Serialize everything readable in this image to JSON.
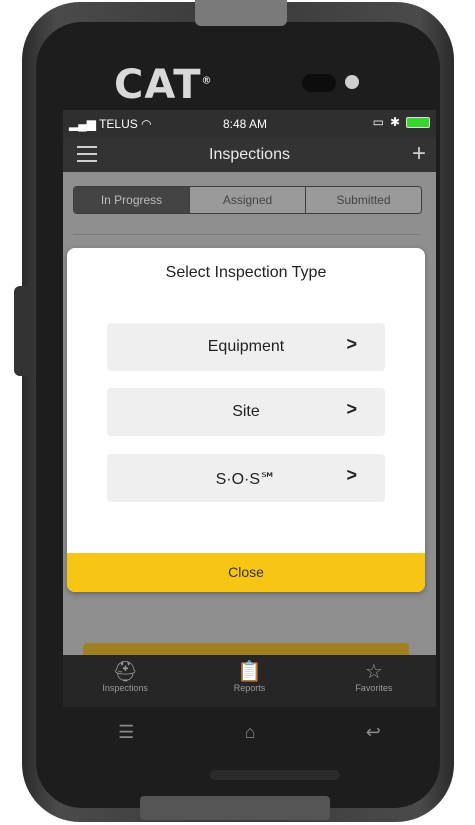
{
  "device": {
    "brand": "CAT"
  },
  "status_bar": {
    "carrier": "TELUS",
    "time": "8:48 AM"
  },
  "header": {
    "title": "Inspections",
    "menu_icon": "hamburger-icon",
    "add_icon": "plus-icon"
  },
  "tabs": [
    {
      "label": "In Progress",
      "active": true
    },
    {
      "label": "Assigned",
      "active": false
    },
    {
      "label": "Submitted",
      "active": false
    }
  ],
  "modal": {
    "title": "Select Inspection Type",
    "options": [
      {
        "label": "Equipment"
      },
      {
        "label": "Site"
      },
      {
        "label": "S·O·S℠"
      }
    ],
    "close_label": "Close"
  },
  "tabbar": [
    {
      "label": "Inspections",
      "icon": "inspections-icon"
    },
    {
      "label": "Reports",
      "icon": "reports-icon"
    },
    {
      "label": "Favorites",
      "icon": "star-icon"
    }
  ],
  "softkeys": [
    "menu-key-icon",
    "home-key-icon",
    "back-key-icon"
  ],
  "colors": {
    "accent": "#f7c514",
    "header_bg": "#333333",
    "overlay": "#8f8f8f"
  }
}
